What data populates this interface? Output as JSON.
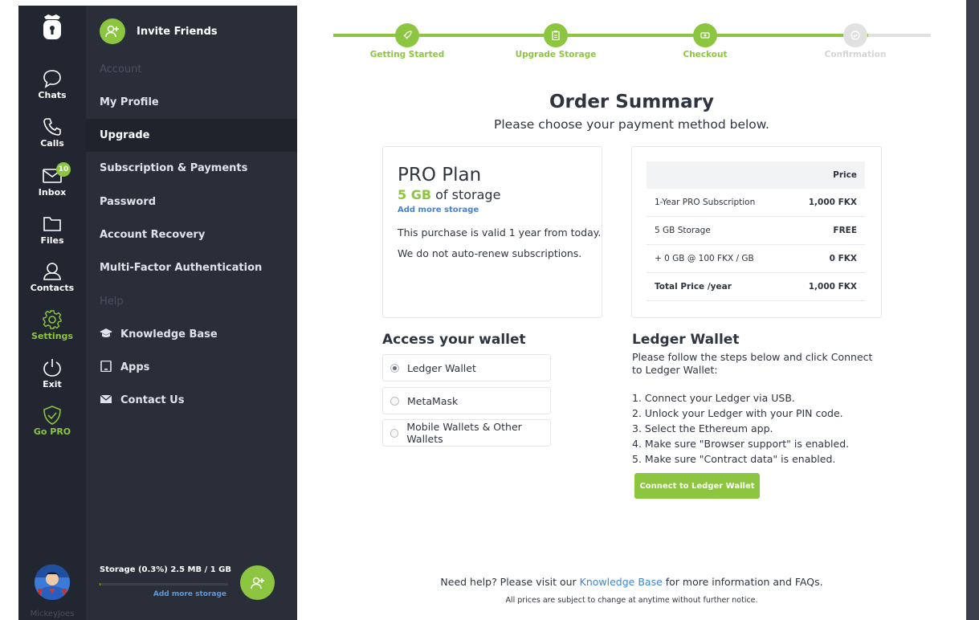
{
  "rail": {
    "items": [
      {
        "label": "Chats",
        "icon": "chat-bubble-icon"
      },
      {
        "label": "Calls",
        "icon": "phone-icon"
      },
      {
        "label": "Inbox",
        "icon": "mail-icon",
        "badge": "10"
      },
      {
        "label": "Files",
        "icon": "folder-icon"
      },
      {
        "label": "Contacts",
        "icon": "person-icon"
      },
      {
        "label": "Settings",
        "icon": "gear-icon",
        "active": true
      },
      {
        "label": "Exit",
        "icon": "power-icon"
      },
      {
        "label": "Go PRO",
        "icon": "shield-check-icon",
        "accent": true
      }
    ],
    "username": "MickeyJoes"
  },
  "menu": {
    "invite_label": "Invite Friends",
    "section_account": "Account",
    "items_account": [
      {
        "label": "My Profile"
      },
      {
        "label": "Upgrade",
        "active": true
      },
      {
        "label": "Subscription & Payments"
      },
      {
        "label": "Password"
      },
      {
        "label": "Account Recovery"
      },
      {
        "label": "Multi-Factor Authentication"
      }
    ],
    "section_help": "Help",
    "items_help": [
      {
        "label": "Knowledge Base",
        "icon": "graduation-cap-icon"
      },
      {
        "label": "Apps",
        "icon": "tablet-icon"
      },
      {
        "label": "Contact Us",
        "icon": "envelope-icon"
      }
    ],
    "storage": {
      "label": "Storage (0.3%)",
      "usage": "2.5 MB / 1 GB",
      "fraction": 0.003,
      "add_link": "Add more storage"
    }
  },
  "progress": {
    "steps": [
      {
        "label": "Getting Started",
        "icon": "rocket-icon",
        "done": true
      },
      {
        "label": "Upgrade Storage",
        "icon": "clipboard-icon",
        "done": true
      },
      {
        "label": "Checkout",
        "icon": "money-icon",
        "done": true
      },
      {
        "label": "Confirmation",
        "icon": "check-circle-icon",
        "done": false
      }
    ]
  },
  "order": {
    "title": "Order Summary",
    "subtitle": "Please choose your payment method below."
  },
  "plan": {
    "name": "PRO Plan",
    "storage_amount": "5 GB",
    "storage_suffix": "of storage",
    "add_storage": "Add more storage",
    "validity": "This purchase is valid 1 year from today.",
    "renew_note": "We do not auto-renew subscriptions."
  },
  "price_table": {
    "header": "Price",
    "rows": [
      {
        "item": "1-Year PRO Subscription",
        "price": "1,000 FKX"
      },
      {
        "item": "5 GB Storage",
        "price": "FREE"
      },
      {
        "item": "+ 0 GB @ 100 FKX / GB",
        "price": "0 FKX"
      },
      {
        "item": "Total Price /year",
        "price": "1,000 FKX"
      }
    ]
  },
  "wallet": {
    "title": "Access your wallet",
    "options": [
      {
        "label": "Ledger Wallet",
        "selected": true
      },
      {
        "label": "MetaMask",
        "selected": false
      },
      {
        "label": "Mobile Wallets & Other Wallets",
        "selected": false
      }
    ]
  },
  "ledger": {
    "title": "Ledger Wallet",
    "description": "Please follow the steps below and click Connect to Ledger Wallet:",
    "steps": [
      "Connect your Ledger via USB.",
      "Unlock your Ledger with your PIN code.",
      "Select the Ethereum app.",
      "Make sure \"Browser support\" is enabled.",
      "Make sure \"Contract data\" is enabled."
    ],
    "button": "Connect to Ledger Wallet"
  },
  "footer": {
    "help_prefix": "Need help? Please visit our",
    "help_link": "Knowledge Base",
    "help_suffix": "for more information and FAQs.",
    "disclaimer": "All prices are subject to change at anytime without further notice."
  },
  "colors": {
    "accent": "#8cc540",
    "rail_bg": "#212630",
    "menu_bg": "#292e39",
    "link": "#3f83d6"
  }
}
